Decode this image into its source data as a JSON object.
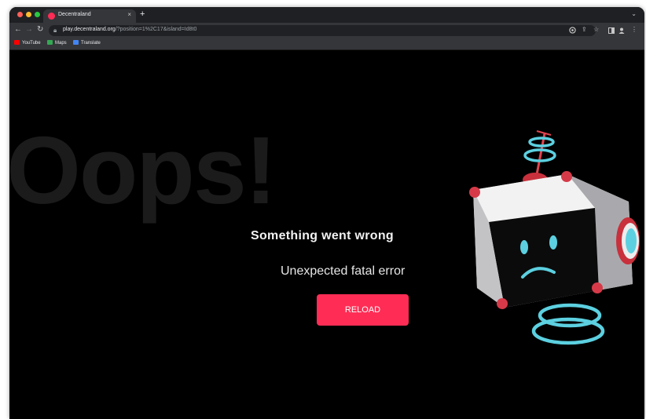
{
  "browser": {
    "tab_title": "Decentraland",
    "tab_close": "×",
    "new_tab": "+",
    "tab_menu": "⌄",
    "url_host": "play.decentraland.org",
    "url_path": "/?position=1%2C17&island=Id8t0",
    "bookmarks": [
      {
        "label": "YouTube",
        "icon": "youtube-icon",
        "color": "#ff0000"
      },
      {
        "label": "Maps",
        "icon": "maps-icon",
        "color": "#34a853"
      },
      {
        "label": "Translate",
        "icon": "translate-icon",
        "color": "#4285f4"
      }
    ],
    "traffic_lights": [
      "#ff5f57",
      "#febc2e",
      "#28c840"
    ]
  },
  "page": {
    "background_word": "Oops!",
    "error_title": "Something went wrong",
    "error_message": "Unexpected fatal error",
    "reload_label": "RELOAD",
    "accent_color": "#ff2d55"
  }
}
